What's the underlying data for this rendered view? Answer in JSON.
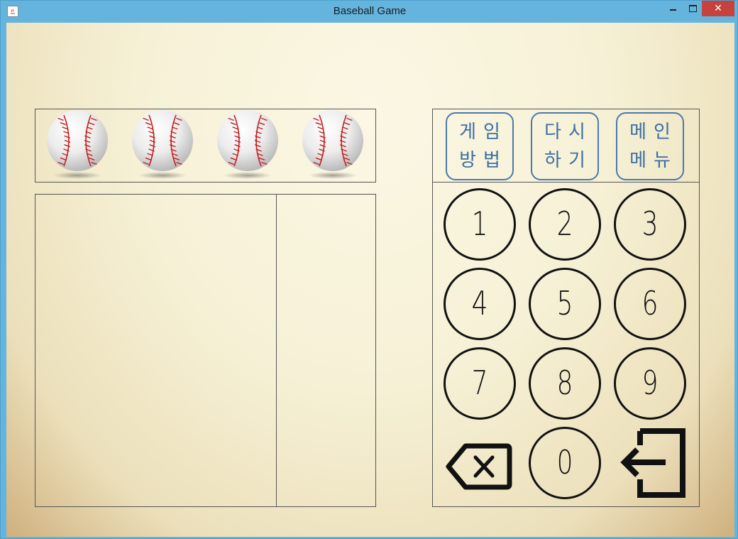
{
  "window": {
    "title": "Baseball Game"
  },
  "balls": [
    {
      "name": "baseball-1"
    },
    {
      "name": "baseball-2"
    },
    {
      "name": "baseball-3"
    },
    {
      "name": "baseball-4"
    }
  ],
  "menu": {
    "how_to_play": {
      "line1": "게임",
      "line2": "방법"
    },
    "restart": {
      "line1": "다시",
      "line2": "하기"
    },
    "main_menu": {
      "line1": "메인",
      "line2": "메뉴"
    }
  },
  "keypad": {
    "keys": [
      "1",
      "2",
      "3",
      "4",
      "5",
      "6",
      "7",
      "8",
      "9"
    ],
    "zero": "0",
    "backspace_icon": "backspace-icon",
    "enter_icon": "enter-icon"
  },
  "colors": {
    "menu_accent": "#3d6ea5",
    "key_stroke": "#111111",
    "stitch": "#c41e1e"
  }
}
